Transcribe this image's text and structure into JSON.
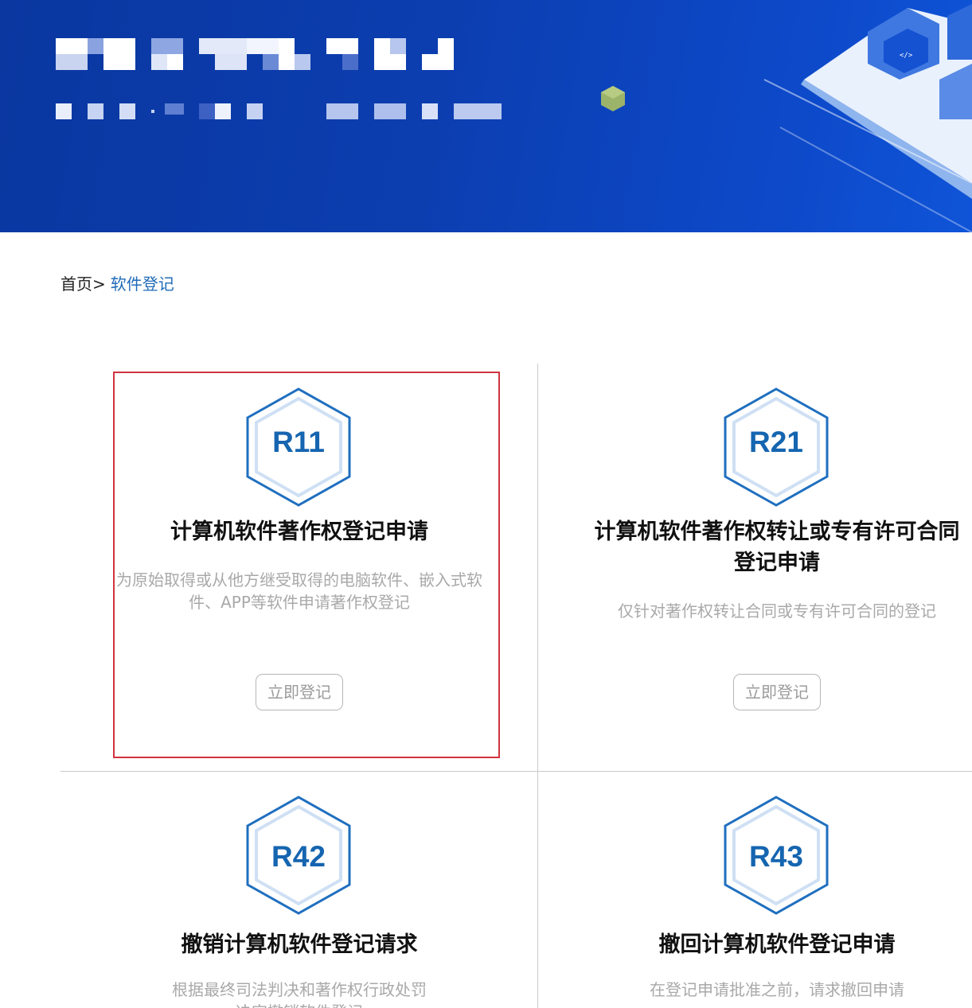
{
  "breadcrumb": {
    "home": "首页>",
    "current": "软件登记"
  },
  "cards": [
    {
      "code": "R11",
      "title": "计算机软件著作权登记申请",
      "desc": "为原始取得或从他方继受取得的电脑软件、嵌入式软件、APP等软件申请著作权登记",
      "button": "立即登记"
    },
    {
      "code": "R21",
      "title": "计算机软件著作权转让或专有许可合同登记申请",
      "desc": "仅针对著作权转让合同或专有许可合同的登记",
      "button": "立即登记"
    },
    {
      "code": "R42",
      "title": "撤销计算机软件登记请求",
      "desc": "根据最终司法判决和著作权行政处罚决定撤销软件登记"
    },
    {
      "code": "R43",
      "title": "撤回计算机软件登记申请",
      "desc": "在登记申请批准之前，请求撤回申请"
    }
  ],
  "colors": {
    "banner": "#0c3eb0",
    "accent": "#1565b0",
    "selected_border": "#d0343f",
    "link": "#1f6bb8"
  }
}
